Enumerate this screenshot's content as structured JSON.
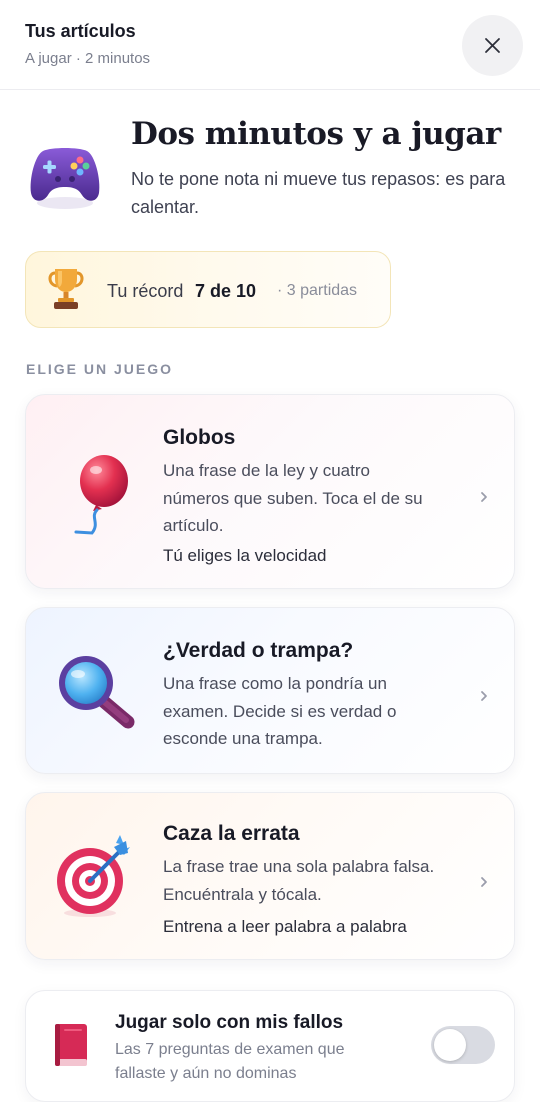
{
  "header": {
    "title": "Tus artículos",
    "subtitle": "A jugar · 2 minutos",
    "close_icon": "close-icon"
  },
  "hero": {
    "icon": "gamepad-icon",
    "title": "Dos minutos y a jugar",
    "description": "No te pone nota ni mueve tus repasos: es para calentar."
  },
  "record": {
    "icon": "trophy-icon",
    "label": "Tu récord",
    "value": "7 de 10",
    "extra": "· 3 partidas"
  },
  "section_label": "ELIGE UN JUEGO",
  "games": [
    {
      "icon": "balloon-icon",
      "title": "Globos",
      "desc_lines": [
        "Una frase de la ley y cuatro",
        "números que suben. Toca el de su",
        "artículo."
      ],
      "note": "Tú eliges la velocidad"
    },
    {
      "icon": "magnifier-icon",
      "title": "¿Verdad o trampa?",
      "desc_lines": [
        "Una frase como la pondría un",
        "examen. Decide si es verdad o",
        "esconde una trampa."
      ],
      "note": ""
    },
    {
      "icon": "target-icon",
      "title": "Caza la errata",
      "desc_lines": [
        "La frase trae una sola palabra falsa.",
        "Encuéntrala y tócala."
      ],
      "note": "Entrena a leer palabra a palabra"
    }
  ],
  "mistakes": {
    "icon": "book-icon",
    "title": "Jugar solo con mis fallos",
    "desc_lines": [
      "Las 7 preguntas de examen que",
      "fallaste y aún no dominas"
    ],
    "toggle_on": false
  },
  "colors": {
    "accent_pink": "#e0315f",
    "accent_blue": "#4aa3f0",
    "accent_purple": "#6b3fb4",
    "muted_text": "#7b7f8e"
  }
}
